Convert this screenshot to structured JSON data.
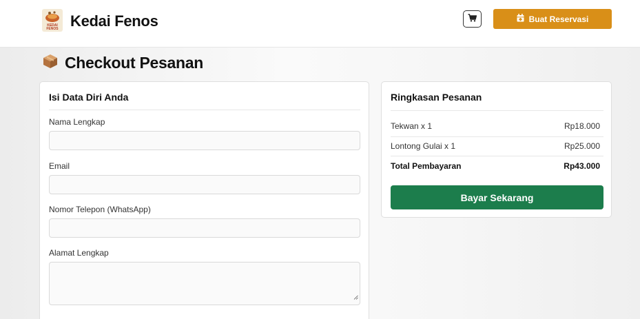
{
  "header": {
    "brand_name": "Kedai Fenos",
    "logo_text": "KEDAI FENOS",
    "reserve_button_label": "Buat Reservasi",
    "cart_icon": "cart-icon",
    "reserve_icon": "calendar-icon"
  },
  "page": {
    "title": "Checkout Pesanan",
    "title_icon": "package-icon"
  },
  "form": {
    "title": "Isi Data Diri Anda",
    "fields": [
      {
        "label": "Nama Lengkap",
        "value": "",
        "placeholder": ""
      },
      {
        "label": "Email",
        "value": "",
        "placeholder": ""
      },
      {
        "label": "Nomor Telepon (WhatsApp)",
        "value": "",
        "placeholder": ""
      },
      {
        "label": "Alamat Lengkap",
        "value": "",
        "placeholder": ""
      }
    ]
  },
  "summary": {
    "title": "Ringkasan Pesanan",
    "items": [
      {
        "name": "Tekwan x 1",
        "price": "Rp18.000"
      },
      {
        "name": "Lontong Gulai x 1",
        "price": "Rp25.000"
      }
    ],
    "total_label": "Total Pembayaran",
    "total_value": "Rp43.000",
    "pay_button_label": "Bayar Sekarang"
  },
  "colors": {
    "accent_orange": "#d98f18",
    "pay_green": "#1c7d4c"
  }
}
